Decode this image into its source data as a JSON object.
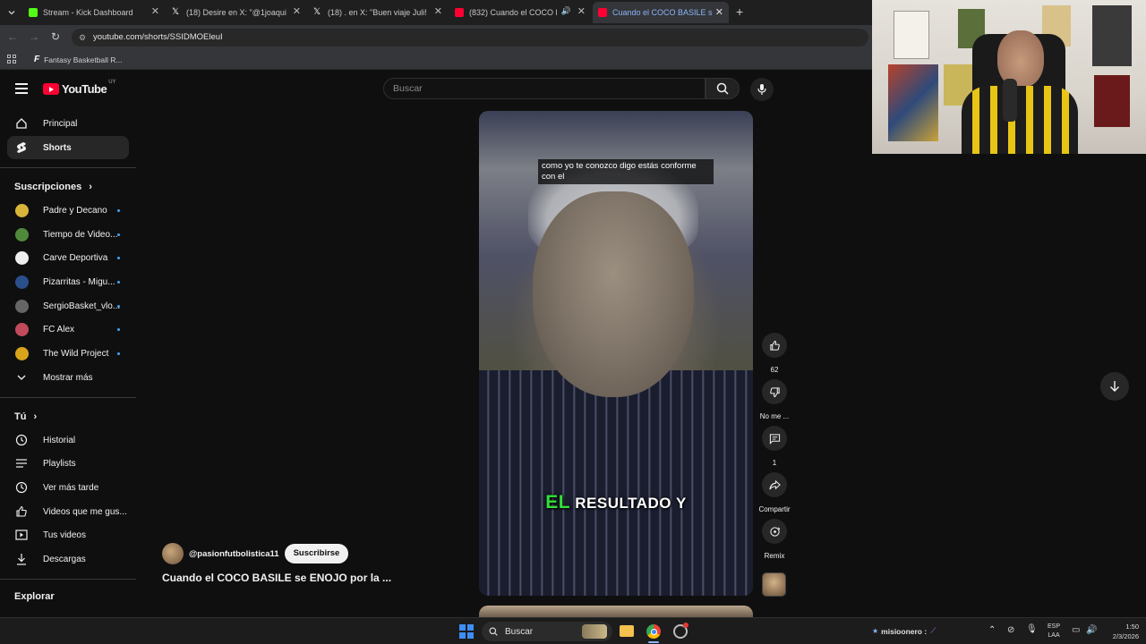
{
  "browser": {
    "tabs": [
      {
        "title": "Stream - Kick Dashboard",
        "icon": "kick-icon",
        "color": "#53fc18",
        "active": false
      },
      {
        "title": "(18) Desire en X: \"@1joaquinm",
        "icon": "x-icon",
        "color": "#ffffff",
        "active": false
      },
      {
        "title": "(18) . en X: \"Buen viaje Juli! htt",
        "icon": "x-icon",
        "color": "#ffffff",
        "active": false
      },
      {
        "title": "(832) Cuando el COCO BAS",
        "icon": "youtube-icon",
        "color": "#ff0033",
        "active": false
      },
      {
        "title": "Cuando el COCO BASILE se ENO",
        "icon": "youtube-icon",
        "color": "#ff0033",
        "active": true
      }
    ],
    "url": "youtube.com/shorts/SSIDMOEleuI",
    "bookmark": "Fantasy Basketball R..."
  },
  "youtube": {
    "logo_text": "YouTube",
    "region": "UY",
    "search_placeholder": "Buscar",
    "nav": [
      {
        "label": "Principal",
        "icon": "home-icon",
        "active": false
      },
      {
        "label": "Shorts",
        "icon": "shorts-icon",
        "active": true
      }
    ],
    "subscriptions_header": "Suscripciones",
    "subscriptions": [
      {
        "label": "Padre y Decano",
        "color": "#d9b43a"
      },
      {
        "label": "Tiempo de Video...",
        "color": "#4f8a3a"
      },
      {
        "label": "Carve Deportiva",
        "color": "#eeeeee"
      },
      {
        "label": "Pizarritas - Migu...",
        "color": "#2a4f8a"
      },
      {
        "label": "SergioBasket_vlo...",
        "color": "#666666"
      },
      {
        "label": "FC Alex",
        "color": "#c24a5a"
      },
      {
        "label": "The Wild Project",
        "color": "#d9a31a"
      }
    ],
    "show_more": "Mostrar más",
    "you_header": "Tú",
    "you_items": [
      {
        "label": "Historial",
        "icon": "history-icon"
      },
      {
        "label": "Playlists",
        "icon": "playlists-icon"
      },
      {
        "label": "Ver más tarde",
        "icon": "clock-icon"
      },
      {
        "label": "Videos que me gus...",
        "icon": "thumbs-up-icon"
      },
      {
        "label": "Tus videos",
        "icon": "your-videos-icon"
      },
      {
        "label": "Descargas",
        "icon": "download-icon"
      }
    ],
    "explore_header": "Explorar",
    "short": {
      "caption": "como yo te conozco digo estás conforme con el",
      "subtitle_highlight": "EL",
      "subtitle_rest": "RESULTADO Y",
      "channel": "@pasionfutbolistica11",
      "subscribe": "Suscribirse",
      "title": "Cuando el COCO BASILE se ENOJO por la ...",
      "likes": "62",
      "dislike_label": "No me ...",
      "comments": "1",
      "share_label": "Compartir",
      "remix_label": "Remix"
    }
  },
  "taskbar": {
    "search": "Buscar",
    "notification": "misioonero :",
    "lang_top": "ESP",
    "lang_bottom": "LAA",
    "time": "1:50",
    "date": "2/3/2026"
  }
}
